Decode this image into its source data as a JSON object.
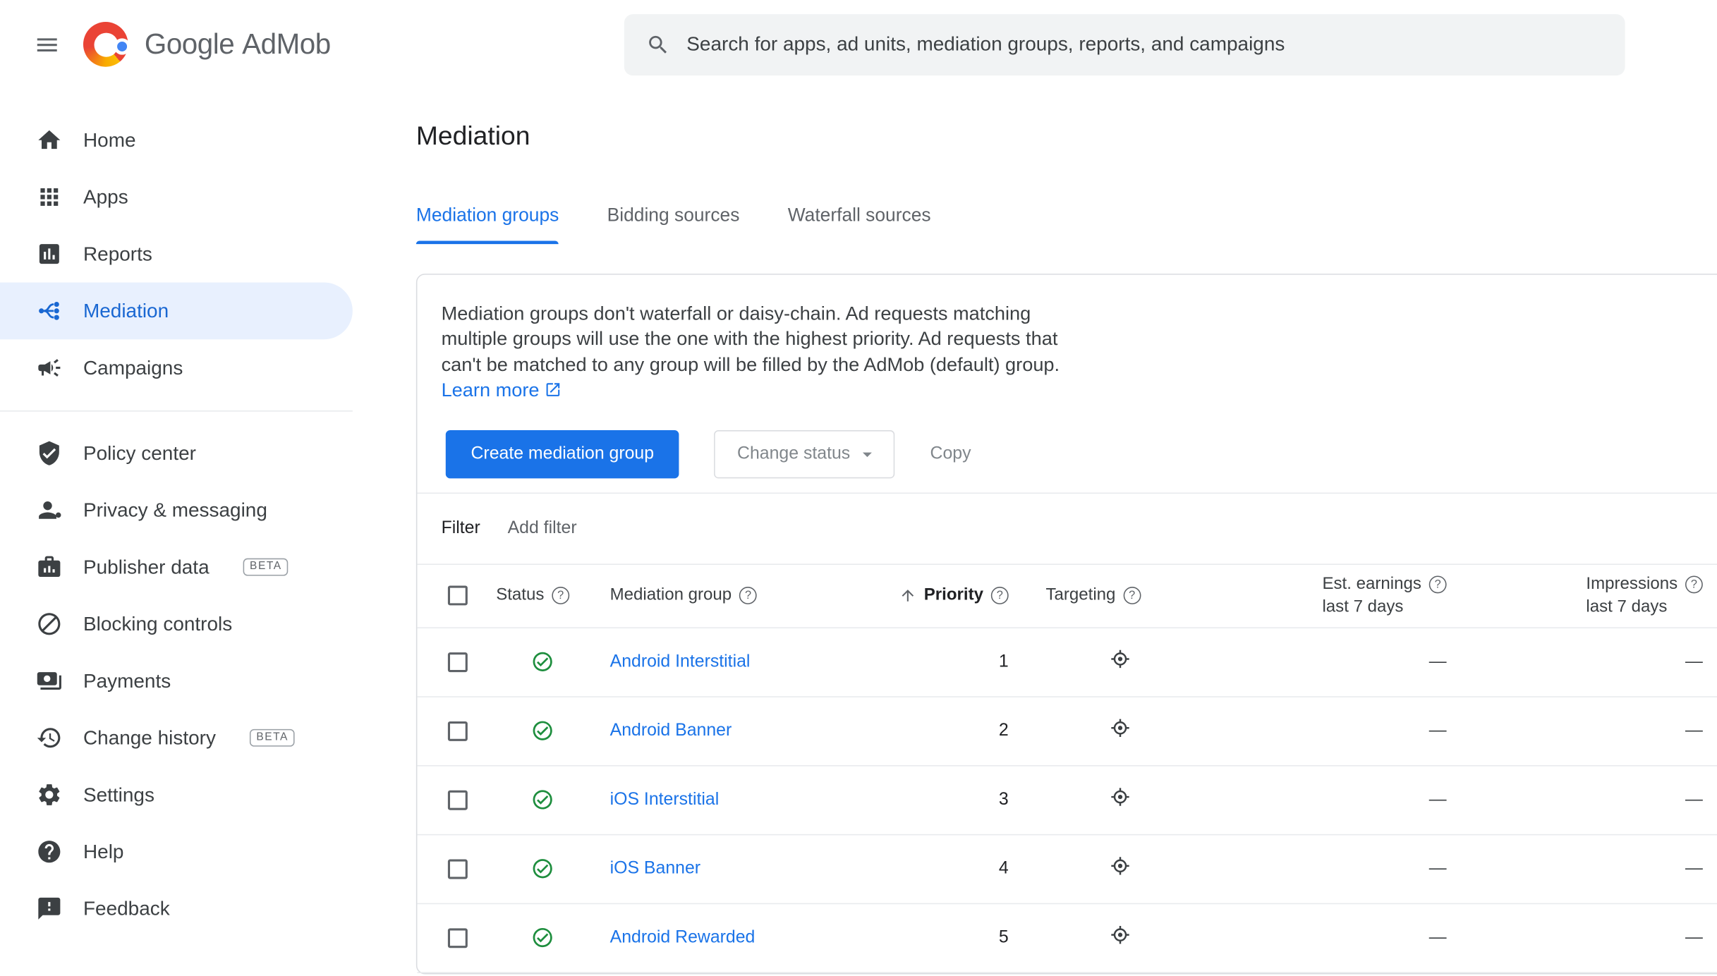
{
  "colors": {
    "accent_blue": "#1a73e8",
    "active_nav_blue": "#1967d2",
    "active_nav_bg": "#e8f0fe",
    "success_green": "#1e8e3e",
    "text_primary": "#202124",
    "text_secondary": "#5f6368",
    "border": "#dadce0",
    "search_bg": "#f1f3f4"
  },
  "header": {
    "logo": {
      "google": "Google",
      "product": "AdMob"
    },
    "search": {
      "placeholder": "Search for apps, ad units, mediation groups, reports, and campaigns"
    }
  },
  "sidebar": {
    "items": [
      {
        "label": "Home",
        "icon": "home-icon"
      },
      {
        "label": "Apps",
        "icon": "apps-grid-icon"
      },
      {
        "label": "Reports",
        "icon": "bar-chart-icon"
      },
      {
        "label": "Mediation",
        "icon": "mediation-icon",
        "active": true
      },
      {
        "label": "Campaigns",
        "icon": "megaphone-icon"
      },
      {
        "label": "Policy center",
        "icon": "shield-check-icon"
      },
      {
        "label": "Privacy & messaging",
        "icon": "person-dot-icon"
      },
      {
        "label": "Publisher data",
        "icon": "briefcase-icon",
        "badge": "BETA"
      },
      {
        "label": "Blocking controls",
        "icon": "block-icon"
      },
      {
        "label": "Payments",
        "icon": "payments-icon"
      },
      {
        "label": "Change history",
        "icon": "history-icon",
        "badge": "BETA"
      },
      {
        "label": "Settings",
        "icon": "gear-icon"
      },
      {
        "label": "Help",
        "icon": "help-icon"
      },
      {
        "label": "Feedback",
        "icon": "feedback-icon"
      }
    ]
  },
  "main": {
    "title": "Mediation",
    "tabs": [
      {
        "label": "Mediation groups",
        "active": true
      },
      {
        "label": "Bidding sources",
        "active": false
      },
      {
        "label": "Waterfall sources",
        "active": false
      }
    ],
    "description": "Mediation groups don't waterfall or daisy-chain. Ad requests matching multiple groups will use the one with the highest priority. Ad requests that can't be matched to any group will be filled by the AdMob (default) group.",
    "learn_more_label": "Learn more",
    "actions": {
      "create_label": "Create mediation group",
      "change_status_label": "Change status",
      "copy_label": "Copy"
    },
    "filter": {
      "label": "Filter",
      "add_label": "Add filter"
    },
    "table": {
      "headers": {
        "status": "Status",
        "mediation_group": "Mediation group",
        "priority": "Priority",
        "targeting": "Targeting",
        "est_earnings": "Est. earnings",
        "impressions": "Impressions",
        "period": "last 7 days"
      },
      "rows": [
        {
          "name": "Android Interstitial",
          "priority": "1",
          "est_earnings": "—",
          "impressions": "—",
          "status": "active"
        },
        {
          "name": "Android Banner",
          "priority": "2",
          "est_earnings": "—",
          "impressions": "—",
          "status": "active"
        },
        {
          "name": "iOS Interstitial",
          "priority": "3",
          "est_earnings": "—",
          "impressions": "—",
          "status": "active"
        },
        {
          "name": "iOS Banner",
          "priority": "4",
          "est_earnings": "—",
          "impressions": "—",
          "status": "active"
        },
        {
          "name": "Android Rewarded",
          "priority": "5",
          "est_earnings": "—",
          "impressions": "—",
          "status": "active"
        }
      ]
    }
  }
}
